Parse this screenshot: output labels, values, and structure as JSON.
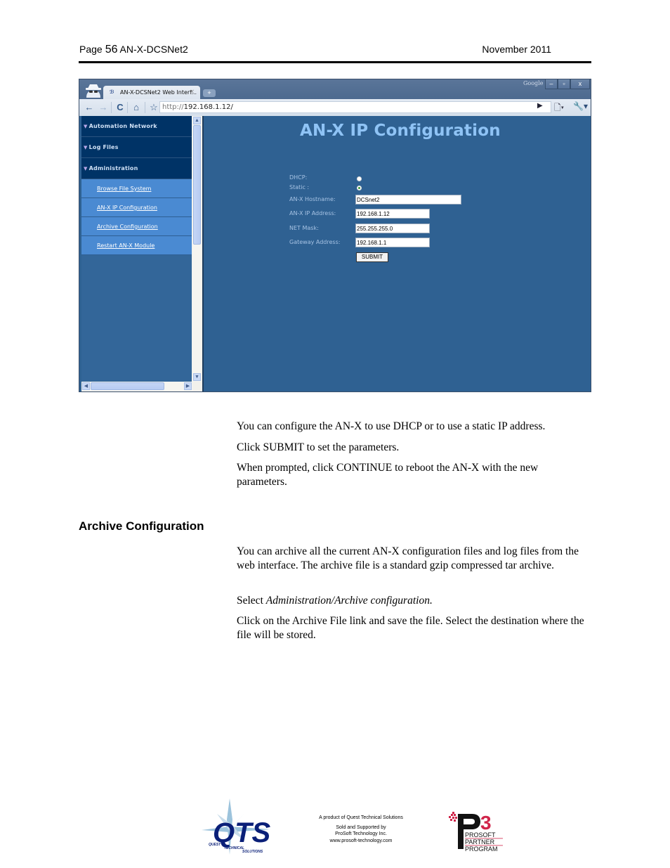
{
  "page_header": {
    "page_label": "Page",
    "page_number": "56",
    "doc_title": "AN-X-DCSNet2",
    "date": "November 2011"
  },
  "browser": {
    "tab_title": "AN-X-DCSNet2 Web Interf...",
    "tab_close": "×",
    "new_tab": "+",
    "google_label": "Google",
    "window_controls": {
      "minimize": "–",
      "maximize": "▫",
      "close": "x"
    },
    "toolbar": {
      "back": "←",
      "forward": "→",
      "reload": "C",
      "home": "⌂",
      "bookmark": "☆",
      "url_scheme": "http://",
      "url_rest": "192.168.1.12/",
      "go": "▶",
      "page_menu": "🗋▾",
      "wrench_menu": "🔧▾"
    },
    "sidebar": {
      "sections": [
        {
          "label": "Automation Network"
        },
        {
          "label": "Log Files"
        },
        {
          "label": "Administration"
        }
      ],
      "admin_items": [
        {
          "label": "Browse File System"
        },
        {
          "label": "AN-X IP Configuration"
        },
        {
          "label": "Archive Configuration"
        },
        {
          "label": "Restart AN-X Module"
        }
      ],
      "triangle": "▼"
    },
    "main": {
      "title": "AN-X IP Configuration",
      "dhcp_label": "DHCP:",
      "static_label": "Static :",
      "ip_mode": "Static",
      "hostname_label": "AN-X Hostname:",
      "hostname_value": "DCSnet2",
      "ip_label": "AN-X IP Address:",
      "ip_value": "192.168.1.12",
      "mask_label": "NET Mask:",
      "mask_value": "255.255.255.0",
      "gateway_label": "Gateway Address:",
      "gateway_value": "192.168.1.1",
      "submit_label": "SUBMIT"
    }
  },
  "body": {
    "p1": "You can configure the AN-X to use DHCP or to use a static IP address.",
    "p2": "Click SUBMIT to set the parameters.",
    "p3": "When prompted, click CONTINUE to reboot the AN-X with the new parameters.",
    "section_heading": "Archive Configuration",
    "p4": "You can archive all the current AN-X configuration files and log files from the web interface.  The archive file is a standard gzip compressed tar archive.",
    "p5_prefix": "Select ",
    "p5_italic": "Administration/Archive configuration.",
    "p6": "Click on the Archive File link and save the file.  Select the destination where the file will be stored."
  },
  "footer": {
    "line1": "A product of Quest Technical Solutions",
    "line2": "Sold and Supported by",
    "line3": "ProSoft Technology Inc.",
    "line4": "www.prosoft-technology.com",
    "qts_logo": {
      "letters": "QTS",
      "words": [
        "QUEST",
        "TECHNICAL",
        "SOLUTIONS"
      ]
    },
    "p3_logo": {
      "mark": "P3",
      "words": [
        "PROSOFT",
        "PARTNER",
        "PROGRAM"
      ]
    }
  },
  "colors": {
    "browser_frame": "#4e6a8e",
    "content_bg": "#2f6192",
    "sidebar_header": "#003366",
    "sidebar_item": "#4a8ad2",
    "title_text": "#8fc3f5",
    "qts_blue": "#0a1f78",
    "p3_red": "#d0254a"
  }
}
